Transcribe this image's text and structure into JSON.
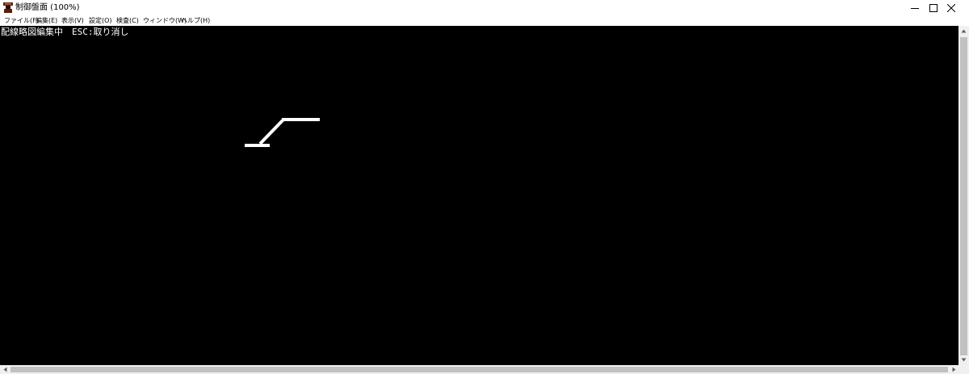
{
  "window": {
    "title": "制御盤面 (100%)",
    "icon": "app-icon",
    "controls": [
      "minimize-icon",
      "maximize-icon",
      "close-icon"
    ]
  },
  "menu": {
    "items": [
      {
        "label": "ファイル(F)"
      },
      {
        "label": "編集(E)"
      },
      {
        "label": "表示(V)"
      },
      {
        "label": "設定(O)"
      },
      {
        "label": "検査(C)"
      },
      {
        "label": "ウィンドウ(W)"
      },
      {
        "label": "ヘルプ(H)"
      }
    ]
  },
  "canvas": {
    "background": "#000000",
    "status": "配線略図編集中　ESC:取り消し",
    "line_color": "#ffffff"
  },
  "scrollbars": {
    "vertical": [
      "scroll-up-icon",
      "scroll-down-icon"
    ],
    "horizontal": [
      "scroll-left-icon",
      "scroll-right-icon"
    ]
  }
}
